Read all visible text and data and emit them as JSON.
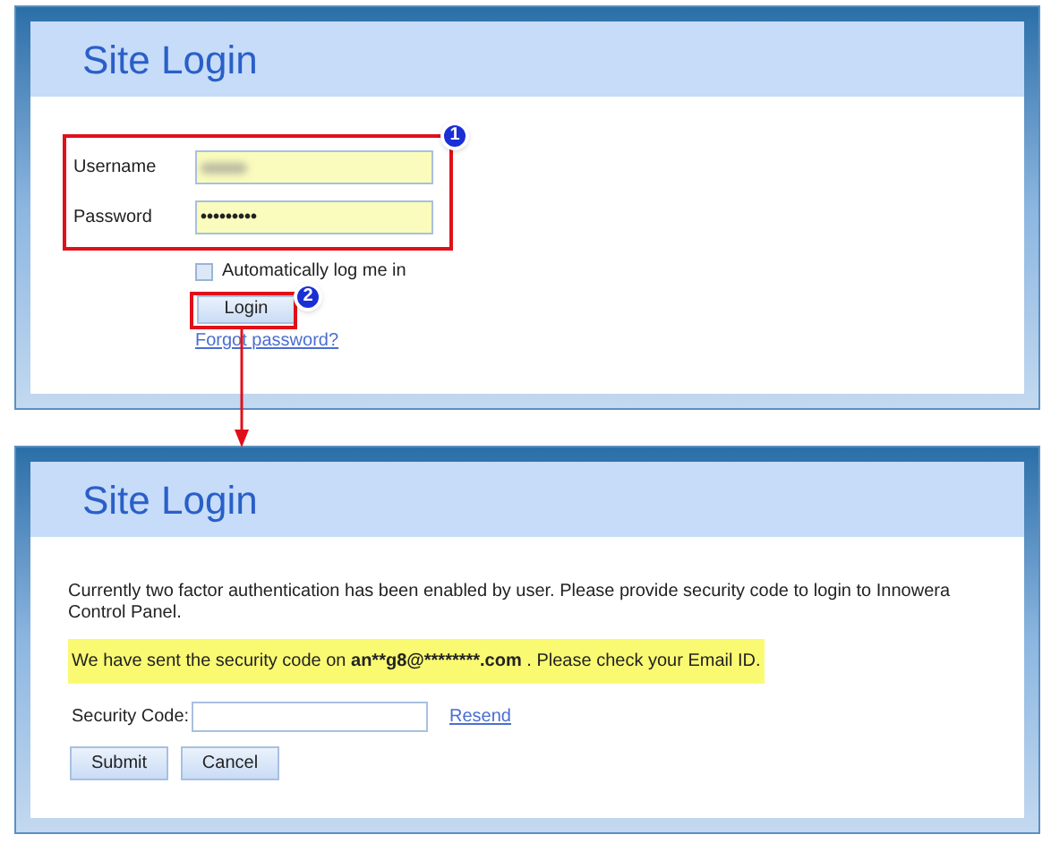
{
  "login_panel": {
    "title": "Site Login",
    "fields": [
      {
        "label": "Username",
        "blurred": true
      },
      {
        "label": "Password",
        "value": "•••••••••",
        "blurred": false
      }
    ],
    "remember": {
      "label": "Automatically log me in",
      "checked": false
    },
    "button": "Login",
    "link": "Forgot password?"
  },
  "code_panel": {
    "title": "Site Login",
    "message": "Currently two factor authentication has been enabled by user. Please provide security code to login to Innowera Control Panel.",
    "notice": {
      "before": "We have sent the security code on",
      "email": "an**g8@********.com",
      "after": ". Please check your Email ID."
    },
    "field_label": "Security Code:",
    "link": "Resend",
    "buttons": [
      "Submit",
      "Cancel"
    ]
  },
  "annotations": [
    {
      "number": "1"
    },
    {
      "number": "2"
    }
  ]
}
